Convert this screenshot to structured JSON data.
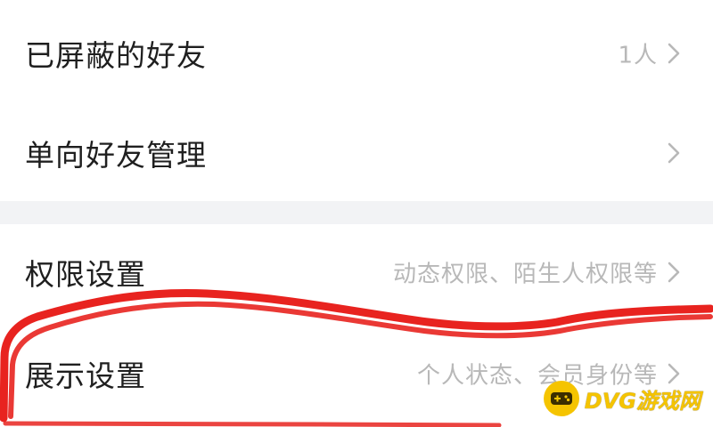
{
  "settings": {
    "items": [
      {
        "label": "已屏蔽的好友",
        "value": "1人"
      },
      {
        "label": "单向好友管理",
        "value": ""
      },
      {
        "label": "权限设置",
        "value": "动态权限、陌生人权限等"
      },
      {
        "label": "展示设置",
        "value": "个人状态、会员身份等"
      }
    ]
  },
  "annotation": {
    "color": "#e8231f"
  },
  "watermark": {
    "text": "DVG游戏网",
    "color": "#f5c400"
  },
  "icons": {
    "row_chevron": "chevron-right-icon",
    "watermark_logo": "gamepad-icon"
  }
}
